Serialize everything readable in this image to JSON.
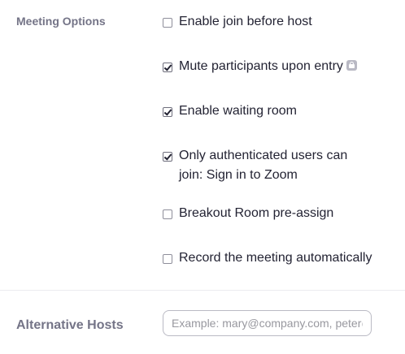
{
  "meeting_options": {
    "label": "Meeting Options",
    "options": [
      {
        "label": "Enable join before host",
        "checked": false
      },
      {
        "label": "Mute participants upon entry",
        "checked": true,
        "badge_icon": "lock-icon"
      },
      {
        "label": "Enable waiting room",
        "checked": true
      },
      {
        "label": "Only authenticated users can join: Sign in to Zoom",
        "checked": true
      },
      {
        "label": "Breakout Room pre-assign",
        "checked": false
      },
      {
        "label": "Record the meeting automatically",
        "checked": false
      }
    ]
  },
  "alternative_hosts": {
    "label": "Alternative Hosts",
    "placeholder": "Example: mary@company.com, peter@school.edu",
    "value": ""
  },
  "colors": {
    "label_gray": "#747487",
    "text": "#232333",
    "divider": "#ececf0"
  }
}
